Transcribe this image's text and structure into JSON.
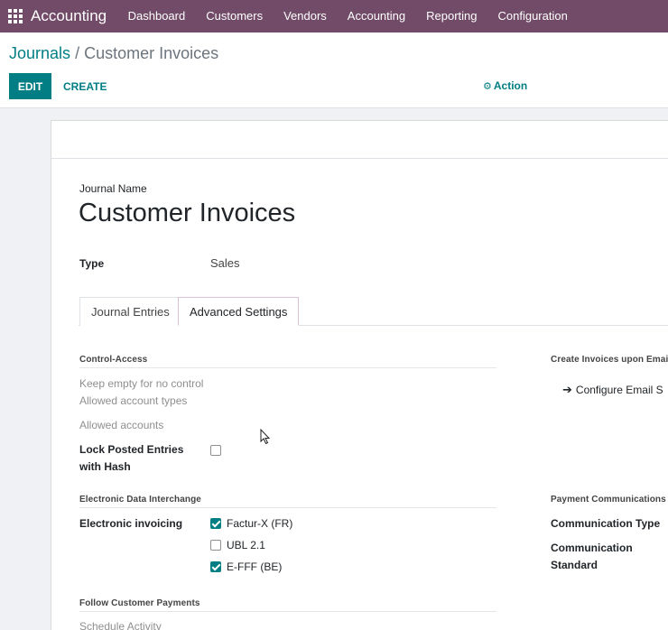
{
  "navbar": {
    "brand": "Accounting",
    "menu": [
      "Dashboard",
      "Customers",
      "Vendors",
      "Accounting",
      "Reporting",
      "Configuration"
    ]
  },
  "breadcrumb": {
    "parent": "Journals",
    "separator": "/",
    "current": "Customer Invoices"
  },
  "buttons": {
    "edit": "EDIT",
    "create": "CREATE",
    "action": "Action"
  },
  "form": {
    "journal_name_label": "Journal Name",
    "journal_name": "Customer Invoices",
    "type_label": "Type",
    "type_value": "Sales"
  },
  "tabs": [
    {
      "label": "Journal Entries",
      "active": false
    },
    {
      "label": "Advanced Settings",
      "active": true
    }
  ],
  "control_access": {
    "title": "Control-Access",
    "keep_empty": "Keep empty for no control",
    "allowed_account_types": "Allowed account types",
    "allowed_accounts": "Allowed accounts",
    "lock_posted_line1": "Lock Posted Entries",
    "lock_posted_line2": "with Hash",
    "lock_posted_checked": false
  },
  "edi": {
    "title": "Electronic Data Interchange",
    "label": "Electronic invoicing",
    "options": [
      {
        "label": "Factur-X (FR)",
        "checked": true
      },
      {
        "label": "UBL 2.1",
        "checked": false
      },
      {
        "label": "E-FFF (BE)",
        "checked": true
      }
    ]
  },
  "follow_payments": {
    "title": "Follow Customer Payments",
    "schedule_activity": "Schedule Activity"
  },
  "right_col": {
    "create_invoices_title": "Create Invoices upon Emai",
    "configure_email": "Configure Email S",
    "payment_comm_title": "Payment Communications",
    "comm_type_label": "Communication Type",
    "comm_standard_line1": "Communication",
    "comm_standard_line2": "Standard"
  },
  "colors": {
    "navbar": "#714b67",
    "primary": "#017e84"
  }
}
